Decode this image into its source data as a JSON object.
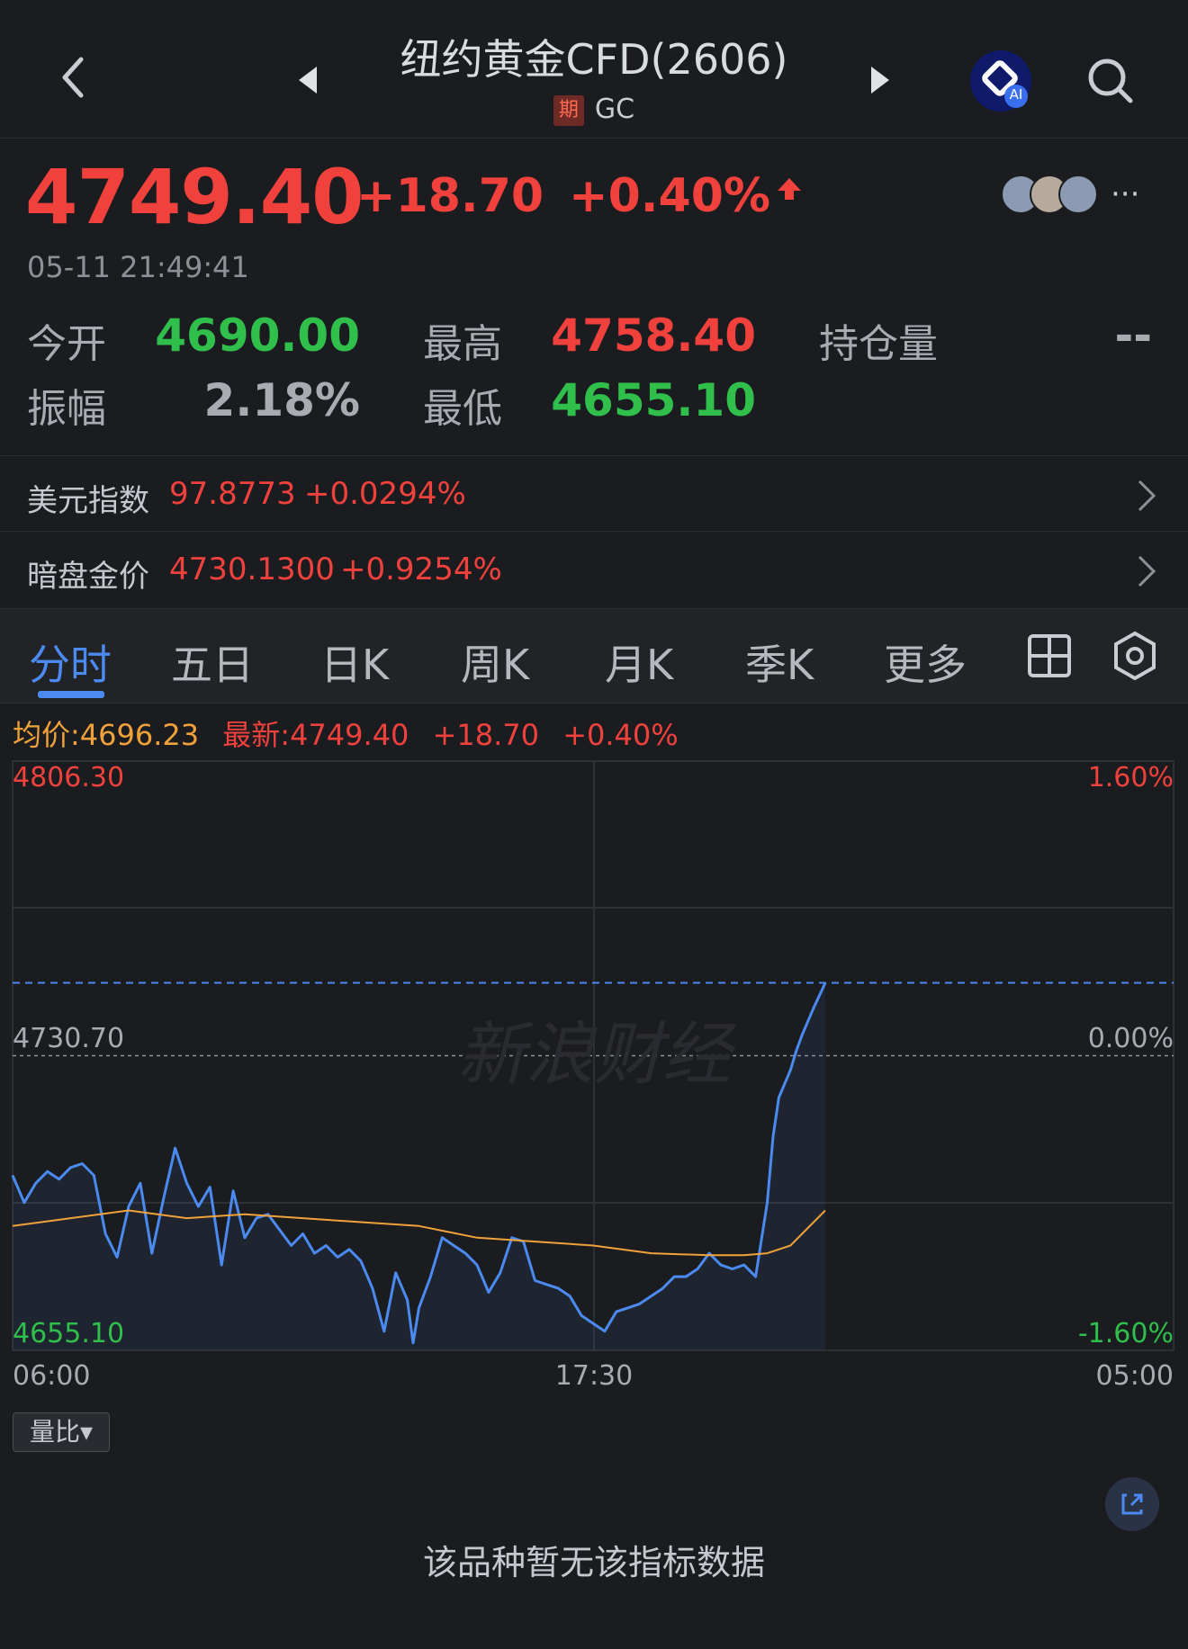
{
  "header": {
    "title": "纽约黄金CFD(2606)",
    "badge": "期",
    "code": "GC",
    "ai_label": "AI"
  },
  "quote": {
    "price": "4749.40",
    "change": "+18.70",
    "change_pct": "+0.40%",
    "time": "05-11 21:49:41",
    "more": "···"
  },
  "stats": {
    "open_label": "今开",
    "open": "4690.00",
    "high_label": "最高",
    "high": "4758.40",
    "oi_label": "持仓量",
    "oi": "--",
    "amp_label": "振幅",
    "amp": "2.18%",
    "low_label": "最低",
    "low": "4655.10"
  },
  "related": [
    {
      "label": "美元指数",
      "value": "97.8773",
      "change": "+0.0294%"
    },
    {
      "label": "暗盘金价",
      "value": "4730.1300",
      "change": "+0.9254%"
    }
  ],
  "tabs": [
    "分时",
    "五日",
    "日K",
    "周K",
    "月K",
    "季K",
    "更多"
  ],
  "active_tab": "分时",
  "legend": {
    "avg": "均价:4696.23",
    "latest": "最新:4749.40",
    "change": "+18.70",
    "pct": "+0.40%"
  },
  "chart_labels": {
    "y_top": "4806.30",
    "y_mid": "4730.70",
    "y_bot": "4655.10",
    "pct_top": "1.60%",
    "pct_mid": "0.00%",
    "pct_bot": "-1.60%",
    "x_start": "06:00",
    "x_mid": "17:30",
    "x_end": "05:00",
    "watermark": "新浪财经"
  },
  "chart_data": {
    "type": "line",
    "ylim": [
      4655.1,
      4806.3
    ],
    "reference": 4730.7,
    "latest": 4749.4,
    "x_ticks": [
      "06:00",
      "17:30",
      "05:00"
    ],
    "series": [
      {
        "name": "最新",
        "color": "#4b8af0",
        "x": [
          0,
          0.01,
          0.02,
          0.03,
          0.04,
          0.05,
          0.06,
          0.07,
          0.08,
          0.09,
          0.1,
          0.11,
          0.12,
          0.13,
          0.14,
          0.15,
          0.16,
          0.17,
          0.18,
          0.19,
          0.2,
          0.21,
          0.22,
          0.23,
          0.24,
          0.25,
          0.26,
          0.27,
          0.28,
          0.29,
          0.3,
          0.31,
          0.32,
          0.33,
          0.34,
          0.345,
          0.35,
          0.36,
          0.37,
          0.38,
          0.39,
          0.4,
          0.41,
          0.42,
          0.43,
          0.44,
          0.45,
          0.46,
          0.47,
          0.48,
          0.49,
          0.5,
          0.51,
          0.52,
          0.53,
          0.54,
          0.55,
          0.56,
          0.57,
          0.58,
          0.59,
          0.6,
          0.61,
          0.62,
          0.63,
          0.64,
          0.65,
          0.655,
          0.66,
          0.67,
          0.675,
          0.68,
          0.69,
          0.7
        ],
        "values": [
          4700,
          4693,
          4698,
          4701,
          4699,
          4702,
          4703,
          4700,
          4685,
          4679,
          4692,
          4698,
          4680,
          4694,
          4707,
          4698,
          4692,
          4697,
          4677,
          4696,
          4684,
          4689,
          4690,
          4686,
          4682,
          4685,
          4680,
          4682,
          4679,
          4681,
          4678,
          4671,
          4660,
          4675,
          4668,
          4657,
          4666,
          4674,
          4684,
          4682,
          4680,
          4677,
          4670,
          4675,
          4684,
          4683,
          4673,
          4672,
          4671,
          4669,
          4664,
          4662,
          4660,
          4665,
          4666,
          4667,
          4669,
          4671,
          4674,
          4674,
          4676,
          4680,
          4677,
          4676,
          4677,
          4674,
          4693,
          4710,
          4720,
          4727,
          4732,
          4736,
          4743,
          4749.4
        ]
      },
      {
        "name": "均价",
        "color": "#f0a13a",
        "x": [
          0,
          0.05,
          0.1,
          0.15,
          0.2,
          0.25,
          0.3,
          0.35,
          0.4,
          0.45,
          0.5,
          0.55,
          0.6,
          0.63,
          0.65,
          0.67,
          0.69,
          0.7
        ],
        "values": [
          4687,
          4689,
          4691,
          4689,
          4690,
          4689,
          4688,
          4687,
          4684,
          4683,
          4682,
          4680,
          4679.5,
          4679.5,
          4680,
          4682,
          4688,
          4691
        ]
      }
    ]
  },
  "indicator": {
    "selector": "量比▾",
    "empty_text": "该品种暂无该指标数据"
  },
  "colors": {
    "up": "#f0413c",
    "down": "#2fbf4a",
    "accent": "#4b8af0",
    "avg": "#f0a13a",
    "background": "#1b1c20"
  },
  "icons": [
    "back-icon",
    "prev-icon",
    "next-icon",
    "ai-assistant-icon",
    "search-icon",
    "up-arrow-icon",
    "chevron-right-icon",
    "grid-icon",
    "settings-icon",
    "expand-icon"
  ]
}
